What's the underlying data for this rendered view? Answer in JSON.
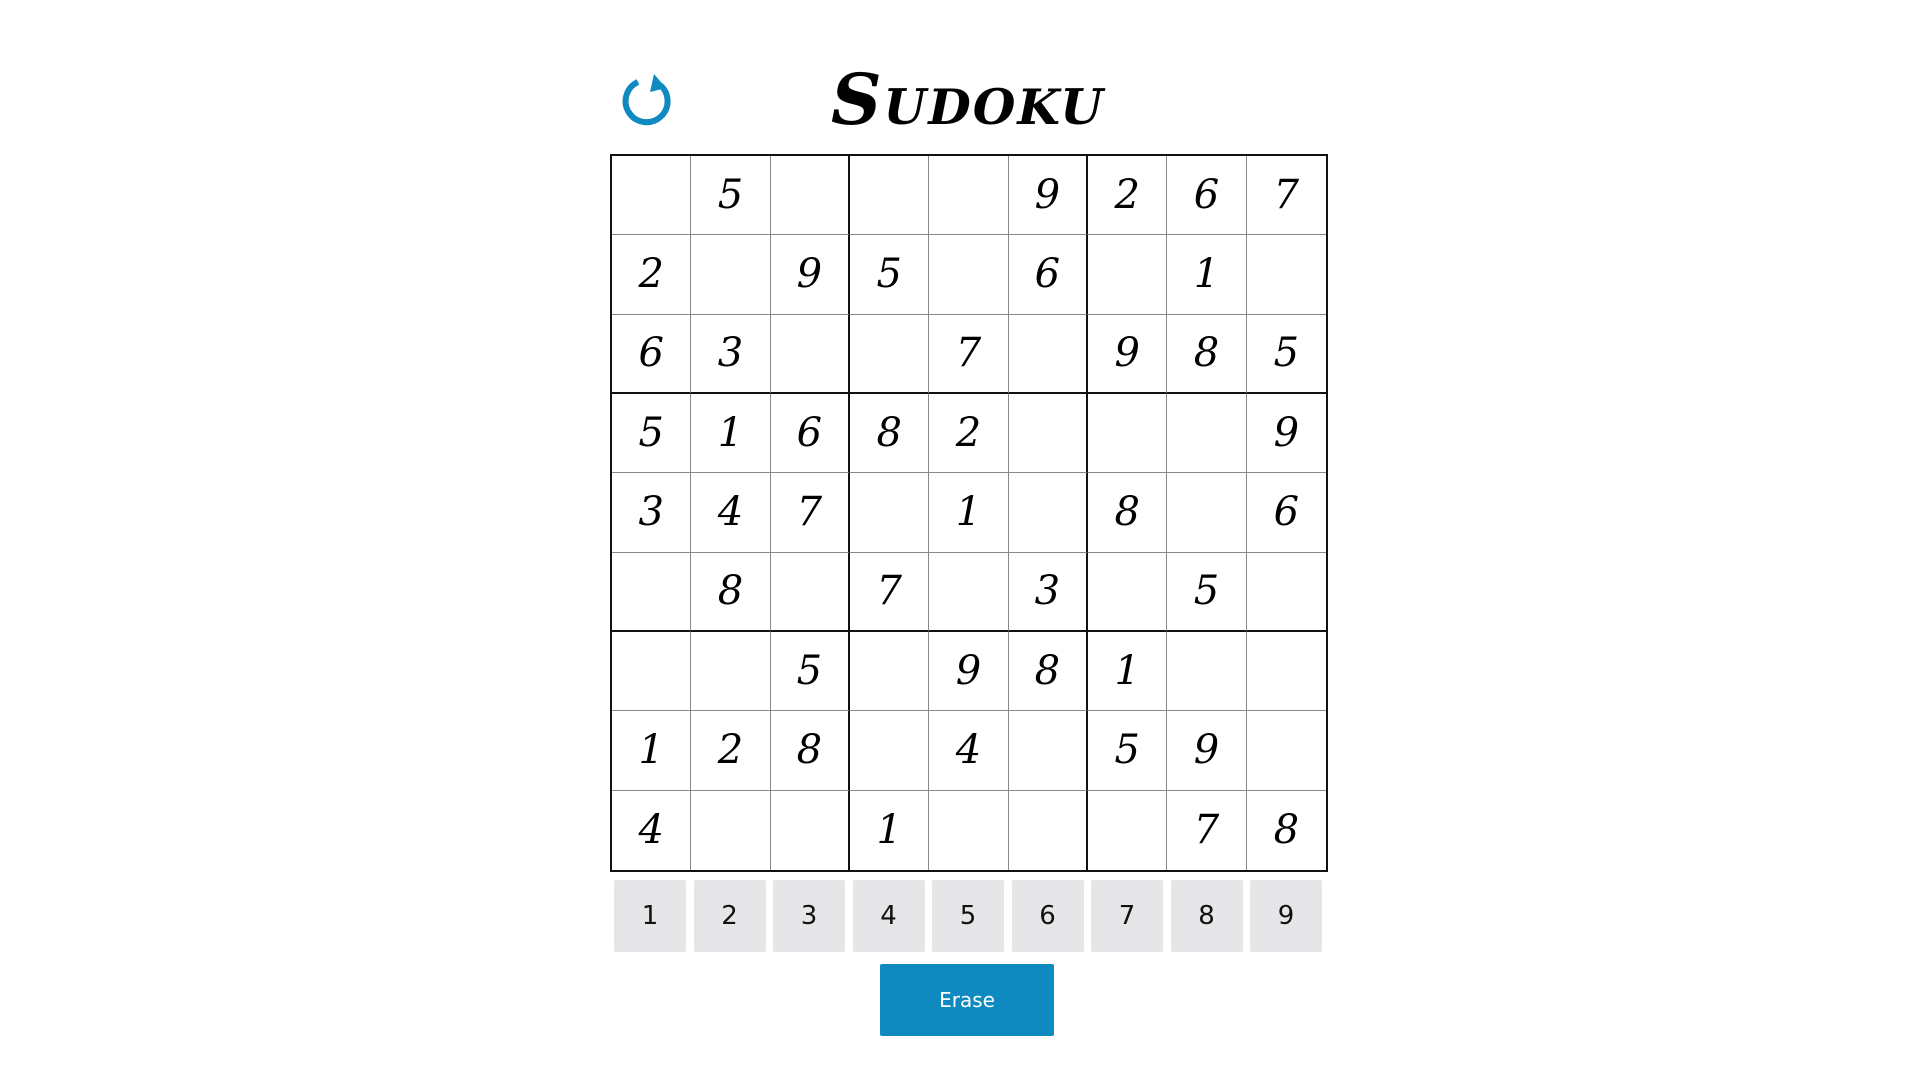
{
  "title": "Sudoku",
  "reset_icon": "reset-icon",
  "colors": {
    "accent": "#0f8ac0",
    "numpad_bg": "#e6e6e9"
  },
  "grid": [
    [
      "",
      "5",
      "",
      "",
      "",
      "9",
      "2",
      "6",
      "7"
    ],
    [
      "2",
      "",
      "9",
      "5",
      "",
      "6",
      "",
      "1",
      ""
    ],
    [
      "6",
      "3",
      "",
      "",
      "7",
      "",
      "9",
      "8",
      "5"
    ],
    [
      "5",
      "1",
      "6",
      "8",
      "2",
      "",
      "",
      "",
      "9"
    ],
    [
      "3",
      "4",
      "7",
      "",
      "1",
      "",
      "8",
      "",
      "6"
    ],
    [
      "",
      "8",
      "",
      "7",
      "",
      "3",
      "",
      "5",
      ""
    ],
    [
      "",
      "",
      "5",
      "",
      "9",
      "8",
      "1",
      "",
      ""
    ],
    [
      "1",
      "2",
      "8",
      "",
      "4",
      "",
      "5",
      "9",
      ""
    ],
    [
      "4",
      "",
      "",
      "1",
      "",
      "",
      "",
      "7",
      "8"
    ]
  ],
  "numpad": [
    "1",
    "2",
    "3",
    "4",
    "5",
    "6",
    "7",
    "8",
    "9"
  ],
  "erase_label": "Erase"
}
